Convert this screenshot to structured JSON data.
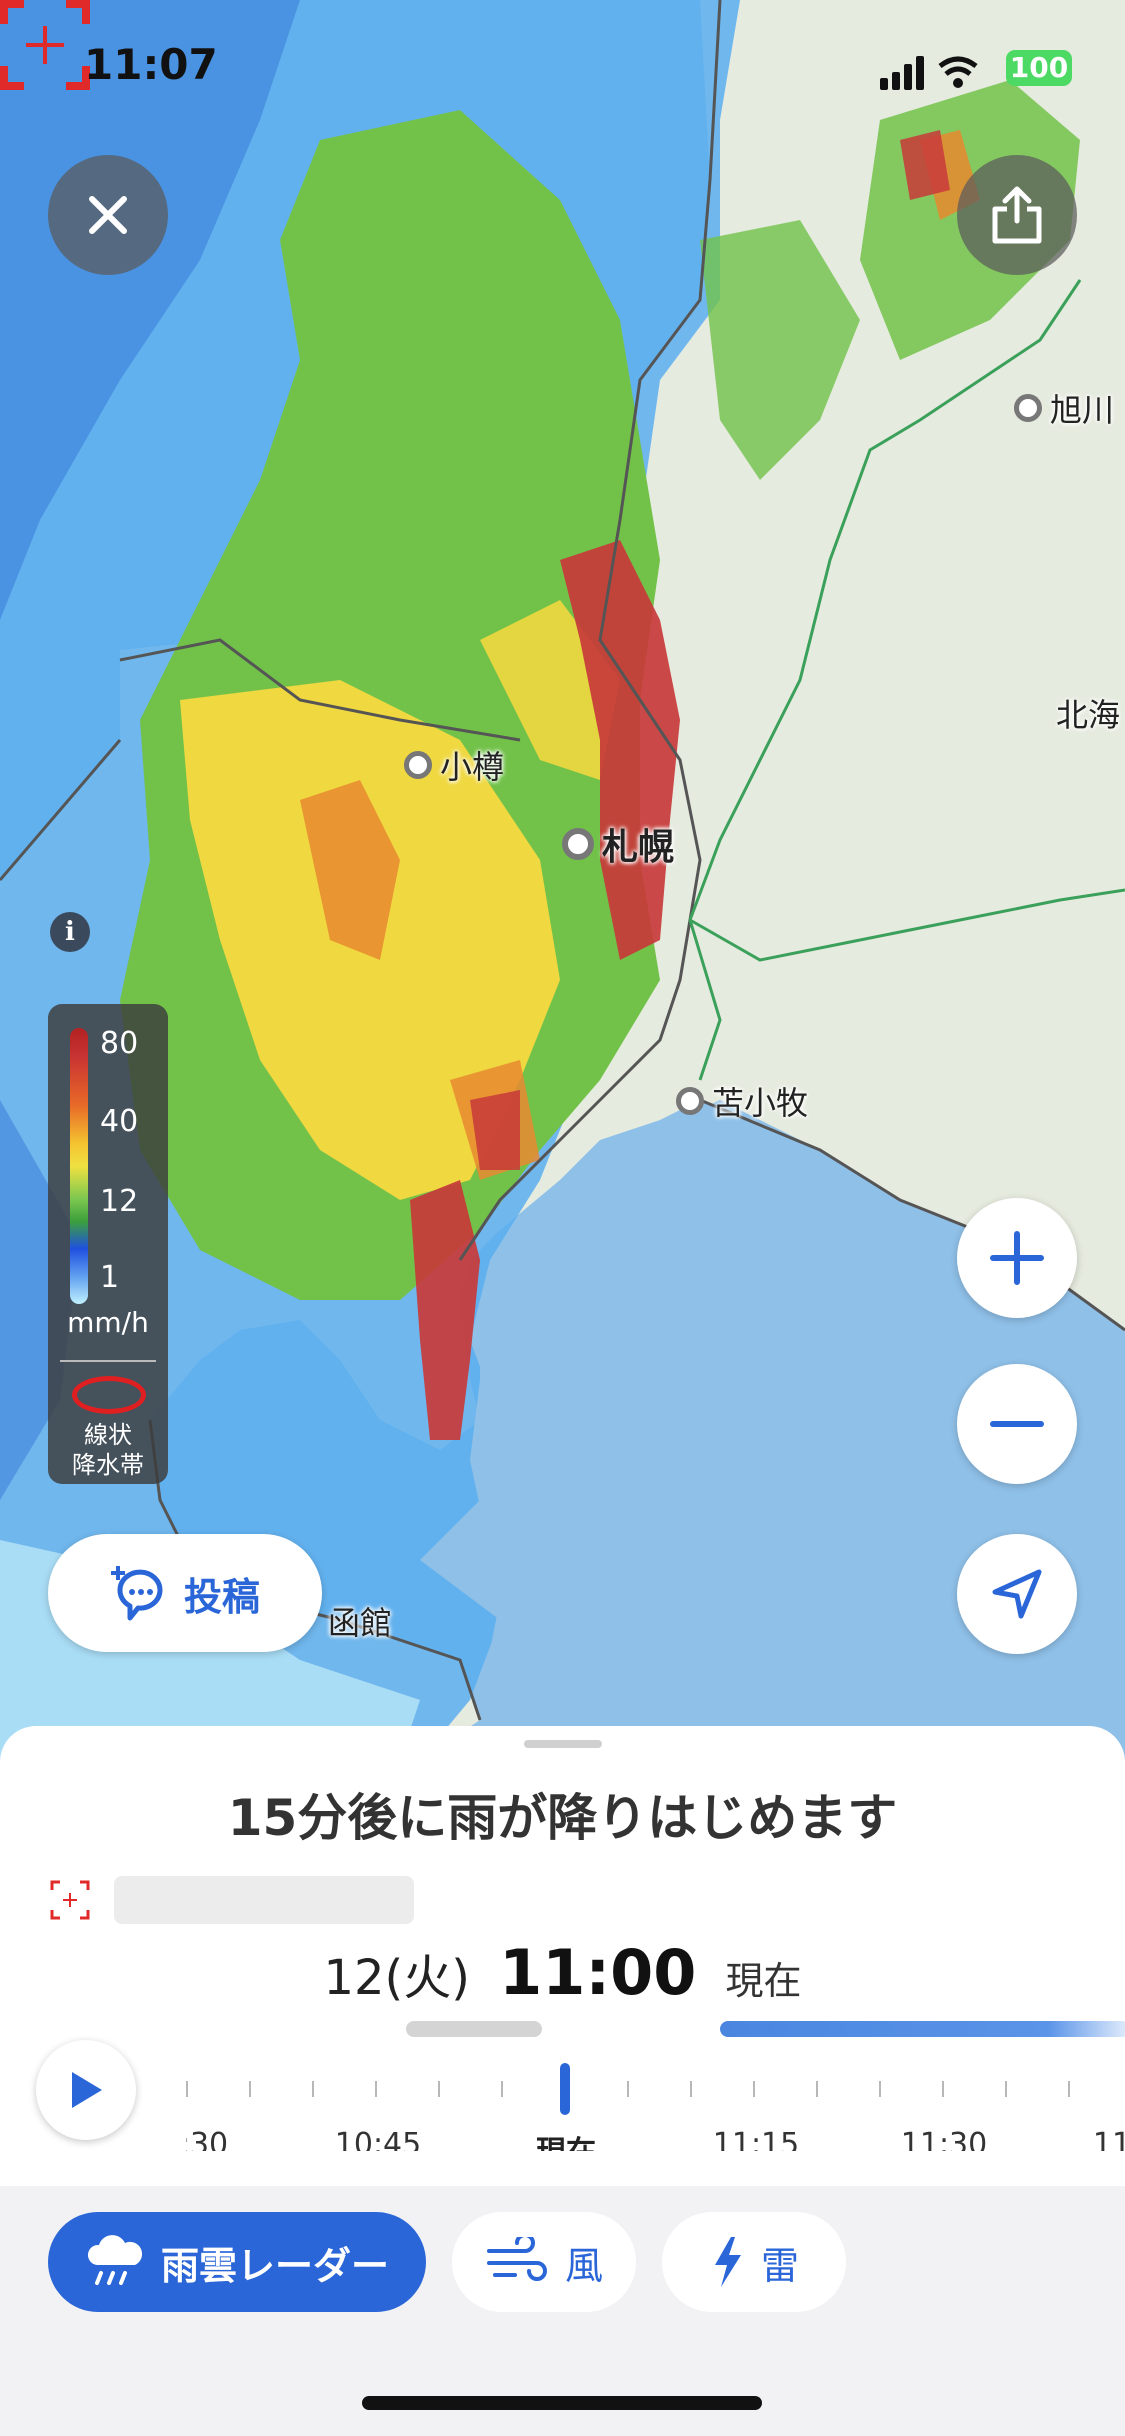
{
  "status_bar": {
    "time": "11:07",
    "battery": "100"
  },
  "map": {
    "cities": [
      {
        "name": "旭川"
      },
      {
        "name": "北海"
      },
      {
        "name": "小樽"
      },
      {
        "name": "札幌"
      },
      {
        "name": "苫小牧"
      },
      {
        "name": "函館"
      }
    ]
  },
  "legend": {
    "levels": [
      "80",
      "40",
      "12",
      "1"
    ],
    "unit": "mm/h",
    "band_line1": "線状",
    "band_line2": "降水帯"
  },
  "post_button": {
    "label": "投稿"
  },
  "sheet": {
    "headline": "15分後に雨が降りはじめます",
    "date": "12(火)",
    "time": "11:00",
    "now_label": "現在"
  },
  "timeline": {
    "labels": [
      ":30",
      "10:45",
      "現在",
      "11:15",
      "11:30",
      "11"
    ]
  },
  "tabs": [
    {
      "label": "雨雲レーダー",
      "active": true
    },
    {
      "label": "風",
      "active": false
    },
    {
      "label": "雷",
      "active": false
    }
  ],
  "colors": {
    "accent": "#2a66d8",
    "sea": "#8fc0e8",
    "land": "#e6ebdf"
  }
}
